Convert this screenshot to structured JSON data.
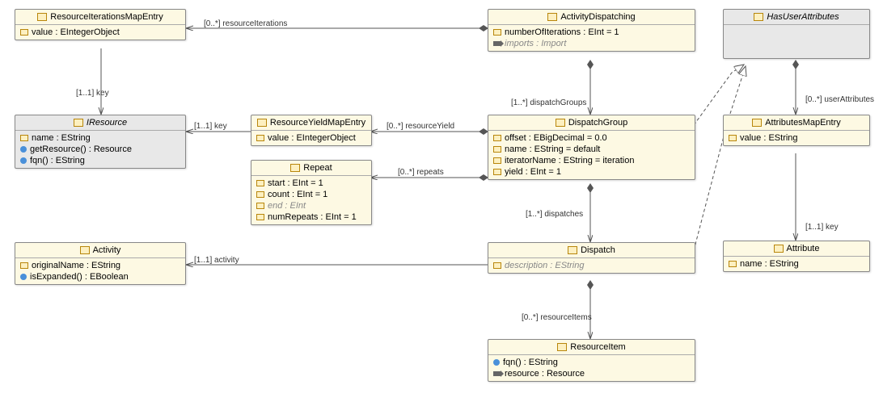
{
  "classes": {
    "resourceIterationsMapEntry": {
      "name": "ResourceIterationsMapEntry",
      "attrs": {
        "value": "value : EIntegerObject"
      }
    },
    "iResource": {
      "name": "IResource",
      "attrs": {
        "name": "name : EString",
        "getResource": "getResource() : Resource",
        "fqn": "fqn() : EString"
      }
    },
    "activity": {
      "name": "Activity",
      "attrs": {
        "originalName": "originalName : EString",
        "isExpanded": "isExpanded() : EBoolean"
      }
    },
    "resourceYieldMapEntry": {
      "name": "ResourceYieldMapEntry",
      "attrs": {
        "value": "value : EIntegerObject"
      }
    },
    "repeat": {
      "name": "Repeat",
      "attrs": {
        "start": "start : EInt = 1",
        "count": "count : EInt = 1",
        "end": "end : EInt",
        "numRepeats": "numRepeats : EInt = 1"
      }
    },
    "activityDispatching": {
      "name": "ActivityDispatching",
      "attrs": {
        "numberOfIterations": "numberOfIterations : EInt = 1",
        "imports": "imports : Import"
      }
    },
    "dispatchGroup": {
      "name": "DispatchGroup",
      "attrs": {
        "offset": "offset : EBigDecimal = 0.0",
        "name": "name : EString = default",
        "iteratorName": "iteratorName : EString = iteration",
        "yield": "yield : EInt = 1"
      }
    },
    "dispatch": {
      "name": "Dispatch",
      "attrs": {
        "description": "description : EString"
      }
    },
    "resourceItem": {
      "name": "ResourceItem",
      "attrs": {
        "fqn": "fqn() : EString",
        "resource": "resource : Resource"
      }
    },
    "hasUserAttributes": {
      "name": "HasUserAttributes"
    },
    "attributesMapEntry": {
      "name": "AttributesMapEntry",
      "attrs": {
        "value": "value : EString"
      }
    },
    "attribute": {
      "name": "Attribute",
      "attrs": {
        "name": "name : EString"
      }
    }
  },
  "labels": {
    "resourceIterations": "[0..*] resourceIterations",
    "key1": "[1..1] key",
    "key2": "[1..1] key",
    "resourceYield": "[0..*] resourceYield",
    "repeats": "[0..*] repeats",
    "activity": "[1..1] activity",
    "dispatchGroups": "[1..*] dispatchGroups",
    "dispatches": "[1..*] dispatches",
    "resourceItems": "[0..*] resourceItems",
    "userAttributes": "[0..*] userAttributes",
    "key3": "[1..1] key"
  }
}
